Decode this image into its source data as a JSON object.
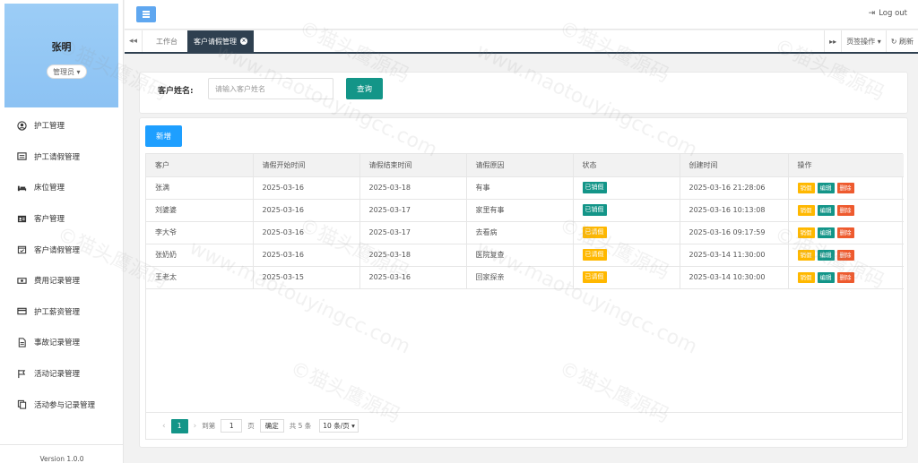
{
  "user": {
    "name": "张明",
    "role": "管理员"
  },
  "sidebar": {
    "items": [
      {
        "label": "护工管理",
        "icon": "user-circle-icon"
      },
      {
        "label": "护工请假管理",
        "icon": "list-icon"
      },
      {
        "label": "床位管理",
        "icon": "bed-icon"
      },
      {
        "label": "客户管理",
        "icon": "id-card-icon"
      },
      {
        "label": "客户请假管理",
        "icon": "calendar-check-icon"
      },
      {
        "label": "费用记录管理",
        "icon": "money-icon"
      },
      {
        "label": "护工薪资管理",
        "icon": "credit-card-icon"
      },
      {
        "label": "事故记录管理",
        "icon": "document-icon"
      },
      {
        "label": "活动记录管理",
        "icon": "flag-icon"
      },
      {
        "label": "活动参与记录管理",
        "icon": "copy-icon"
      }
    ],
    "version": "Version 1.0.0"
  },
  "header": {
    "logout": "Log out"
  },
  "tabs": {
    "home": "工作台",
    "active": "客户请假管理",
    "page_ops": "页签操作",
    "refresh": "刷新"
  },
  "search": {
    "label": "客户姓名:",
    "placeholder": "请输入客户姓名",
    "value": "",
    "button": "查询"
  },
  "toolbar": {
    "add_label": "新增"
  },
  "table": {
    "columns": [
      "客户",
      "请假开始时间",
      "请假结束时间",
      "请假原因",
      "状态",
      "创建时间",
      "操作"
    ],
    "rows": [
      {
        "customer": "张满",
        "start": "2025-03-16",
        "end": "2025-03-18",
        "reason": "有事",
        "status": "已销假",
        "status_color": "#139588",
        "created": "2025-03-16 21:28:06"
      },
      {
        "customer": "刘婆婆",
        "start": "2025-03-16",
        "end": "2025-03-17",
        "reason": "家里有事",
        "status": "已销假",
        "status_color": "#139588",
        "created": "2025-03-16 10:13:08"
      },
      {
        "customer": "李大爷",
        "start": "2025-03-16",
        "end": "2025-03-17",
        "reason": "去看病",
        "status": "已请假",
        "status_color": "#ffb800",
        "created": "2025-03-16 09:17:59"
      },
      {
        "customer": "张奶奶",
        "start": "2025-03-16",
        "end": "2025-03-18",
        "reason": "医院复查",
        "status": "已请假",
        "status_color": "#ffb800",
        "created": "2025-03-14 11:30:00"
      },
      {
        "customer": "王老太",
        "start": "2025-03-15",
        "end": "2025-03-16",
        "reason": "回家探亲",
        "status": "已请假",
        "status_color": "#ffb800",
        "created": "2025-03-14 10:30:00"
      }
    ],
    "actions": {
      "cancel_leave": "销假",
      "edit": "编辑",
      "delete": "删除"
    }
  },
  "pager": {
    "current_page": "1",
    "goto_prefix": "到第",
    "goto_value": "1",
    "goto_suffix": "页",
    "confirm": "确定",
    "total": "共 5 条",
    "page_size": "10 条/页"
  },
  "watermark": {
    "text_cn": "©猫头鹰源码",
    "text_url": "www.maotouyingcc.com"
  },
  "colors": {
    "primary": "#139588",
    "blue": "#1e9fff",
    "warning": "#ffb800",
    "danger": "#ee5a2e",
    "dark": "#2f4050"
  }
}
